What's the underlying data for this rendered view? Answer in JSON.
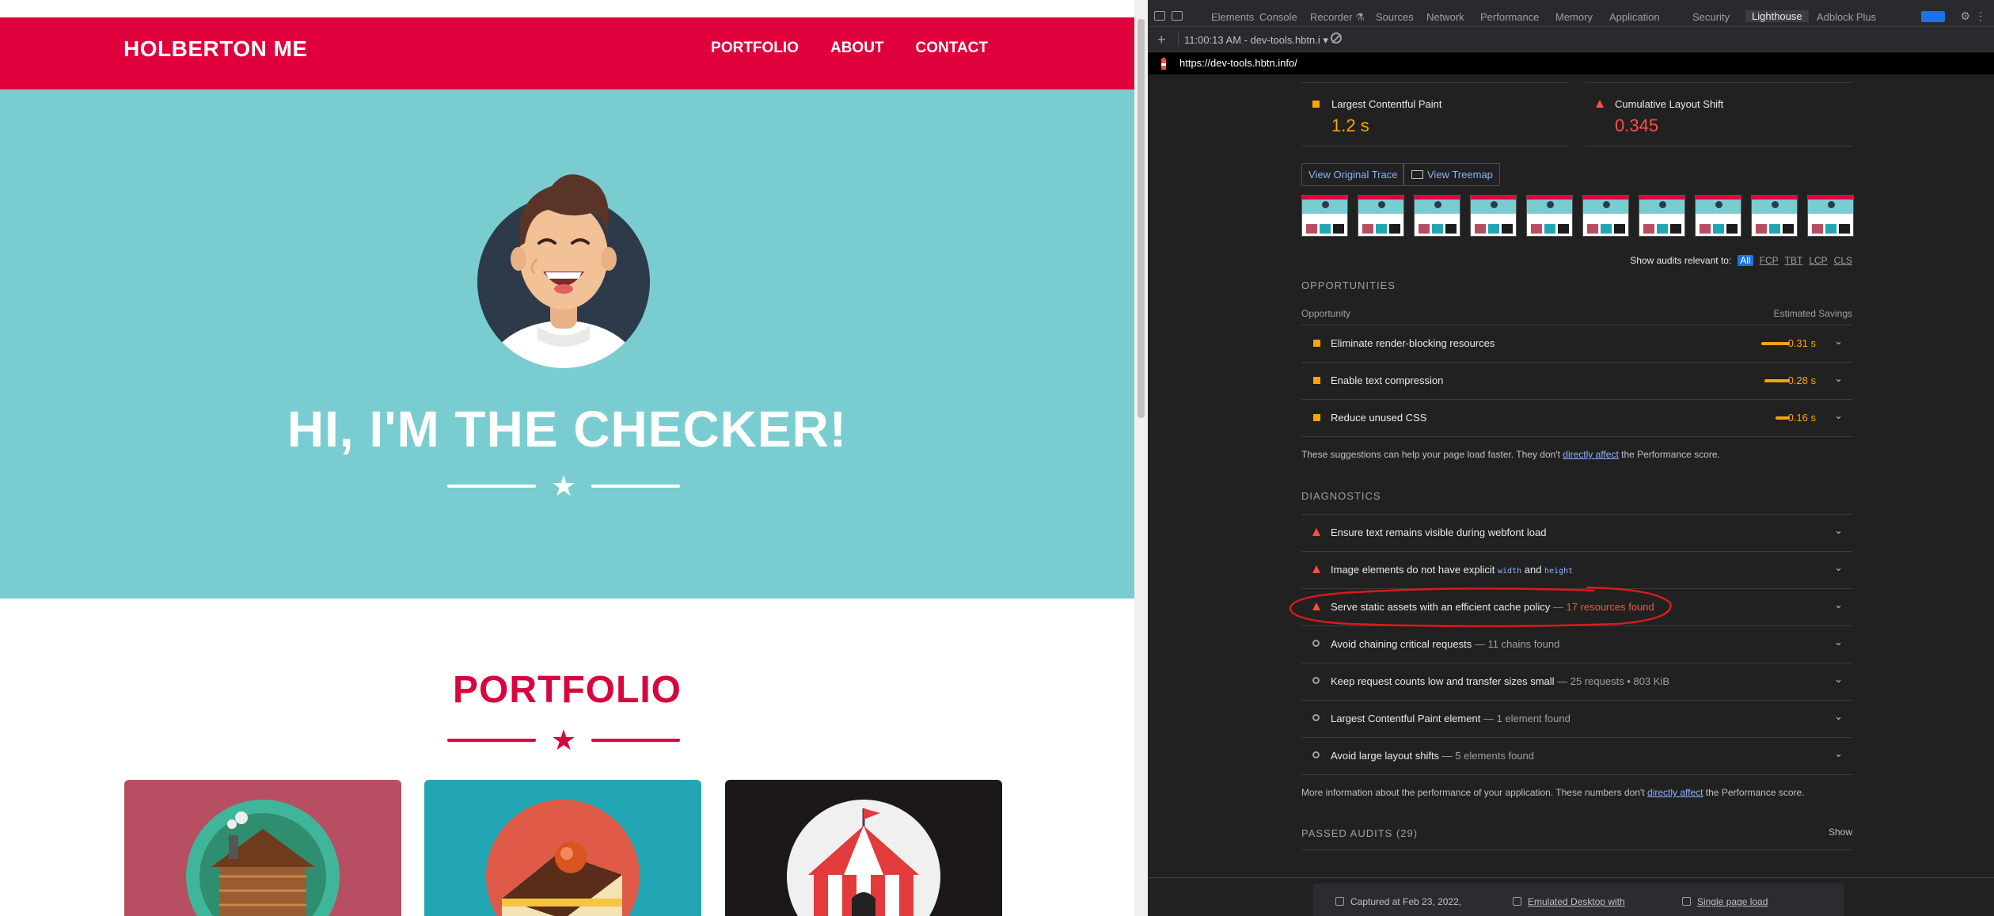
{
  "site": {
    "brand": "HOLBERTON ME",
    "nav": [
      "PORTFOLIO",
      "ABOUT",
      "CONTACT"
    ],
    "hero_title": "HI, I'M THE CHECKER!",
    "portfolio_title": "PORTFOLIO",
    "colors": {
      "navbar": "#e0003c",
      "hero": "#79cdd0",
      "accent": "#d8063e"
    }
  },
  "devtools": {
    "tabs": [
      "Elements",
      "Console",
      "Recorder ⚗",
      "Sources",
      "Network",
      "Performance",
      "Memory",
      "Application",
      "Security",
      "Lighthouse",
      "Adblock Plus"
    ],
    "active_tab": "Lighthouse",
    "toolbar": {
      "add": "+",
      "report_select": "11:00:13 AM - dev-tools.hbtn.i ▾"
    },
    "url": "https://dev-tools.hbtn.info/",
    "metrics": [
      {
        "name": "Largest Contentful Paint",
        "value": "1.2 s",
        "status": "average",
        "color": "#ffa400"
      },
      {
        "name": "Cumulative Layout Shift",
        "value": "0.345",
        "status": "fail",
        "color": "#ff4e42"
      }
    ],
    "buttons": {
      "original_trace": "View Original Trace",
      "treemap": "View Treemap"
    },
    "filmstrip_count": 10,
    "relevant": {
      "label": "Show audits relevant to:",
      "filters": [
        "All",
        "FCP",
        "TBT",
        "LCP",
        "CLS"
      ],
      "active": "All"
    },
    "opportunities": {
      "heading": "OPPORTUNITIES",
      "col_opportunity": "Opportunity",
      "col_savings": "Estimated Savings",
      "items": [
        {
          "title": "Eliminate render-blocking resources",
          "savings": "0.31 s"
        },
        {
          "title": "Enable text compression",
          "savings": "0.28 s"
        },
        {
          "title": "Reduce unused CSS",
          "savings": "0.16 s"
        }
      ],
      "note_pre": "These suggestions can help your page load faster. They don't ",
      "note_link": "directly affect",
      "note_post": " the Performance score."
    },
    "diagnostics": {
      "heading": "DIAGNOSTICS",
      "items": [
        {
          "title": "Ensure text remains visible during webfont load",
          "extra": "",
          "type": "fail"
        },
        {
          "title_pre": "Image elements do not have explicit ",
          "code1": "width",
          "mid": " and ",
          "code2": "height",
          "type": "fail"
        },
        {
          "title": "Serve static assets with an efficient cache policy",
          "extra": " — 17 resources found",
          "type": "fail"
        },
        {
          "title": "Avoid chaining critical requests",
          "extra": " — 11 chains found",
          "type": "info"
        },
        {
          "title": "Keep request counts low and transfer sizes small",
          "extra": " — 25 requests • 803 KiB",
          "type": "info"
        },
        {
          "title": "Largest Contentful Paint element",
          "extra": " — 1 element found",
          "type": "info"
        },
        {
          "title": "Avoid large layout shifts",
          "extra": " — 5 elements found",
          "type": "info"
        }
      ],
      "note_pre": "More information about the performance of your application. These numbers don't ",
      "note_link": "directly affect",
      "note_post": " the Performance score."
    },
    "passed": {
      "heading": "PASSED AUDITS (29)",
      "show": "Show"
    },
    "footer": {
      "captured": "Captured at Feb 23, 2022,",
      "emulated": "Emulated Desktop with",
      "single": "Single page load"
    }
  }
}
